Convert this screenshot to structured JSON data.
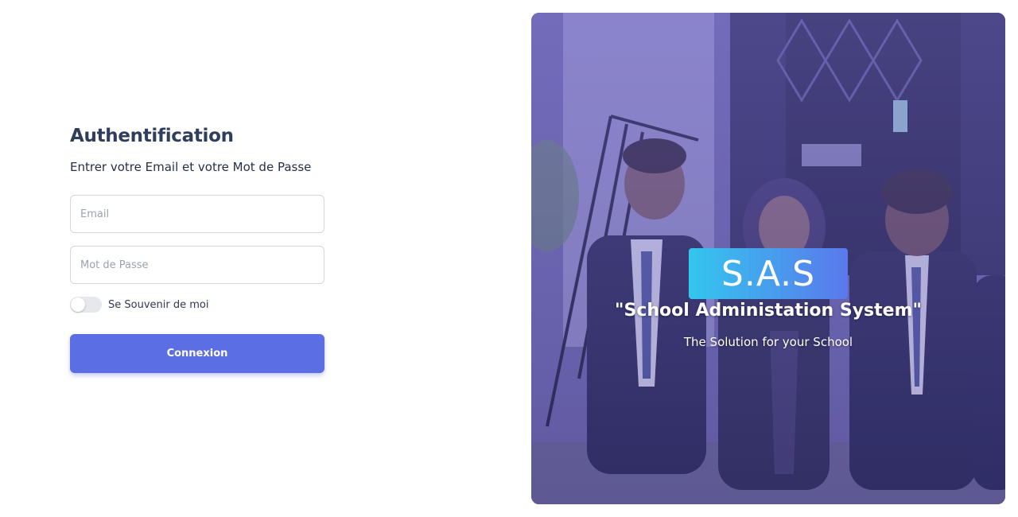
{
  "login": {
    "title": "Authentification",
    "subtitle": "Entrer votre Email et votre Mot de Passe",
    "email_placeholder": "Email",
    "password_placeholder": "Mot de Passe",
    "remember_label": "Se Souvenir de moi",
    "remember_checked": false,
    "submit_label": "Connexion"
  },
  "hero": {
    "brand": "S.A.S",
    "tagline": "\"School Administation System\"",
    "slogan": "The Solution for your School"
  },
  "colors": {
    "primary_button": "#5c6ee3",
    "brand_gradient_start": "#33c6ee",
    "brand_gradient_end": "#5b78ec",
    "title_text": "#2f3e5b"
  }
}
